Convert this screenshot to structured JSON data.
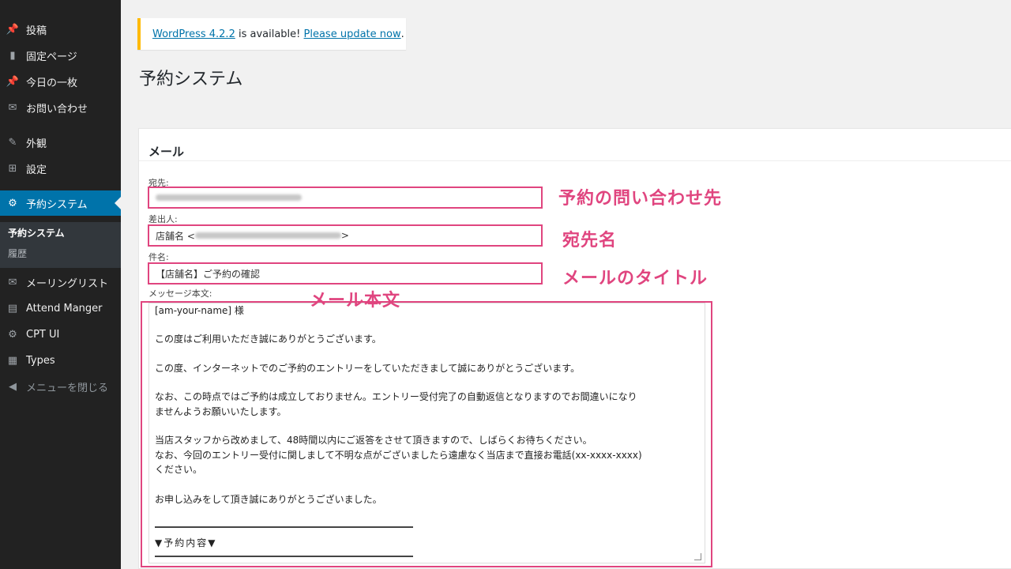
{
  "sidebar": {
    "items": [
      {
        "label": "投稿",
        "icon": "pin-icon"
      },
      {
        "label": "固定ページ",
        "icon": "page-icon"
      },
      {
        "label": "今日の一枚",
        "icon": "pin-icon"
      },
      {
        "label": "お問い合わせ",
        "icon": "mail-icon"
      },
      {
        "label": "外観",
        "icon": "brush-icon"
      },
      {
        "label": "設定",
        "icon": "settings-icon"
      },
      {
        "label": "予約システム",
        "icon": "gear-icon"
      },
      {
        "label": "メーリングリスト",
        "icon": "mail-icon"
      },
      {
        "label": "Attend Manger",
        "icon": "list-icon"
      },
      {
        "label": "CPT UI",
        "icon": "gear-icon"
      },
      {
        "label": "Types",
        "icon": "calendar-icon"
      },
      {
        "label": "メニューを閉じる",
        "icon": "collapse-icon"
      }
    ],
    "submenu": [
      "予約システム",
      "履歴"
    ]
  },
  "notice": {
    "version_link": "WordPress 4.2.2",
    "middle_text": " is available! ",
    "update_link": "Please update now",
    "end_text": "."
  },
  "page_title": "予約システム",
  "panel": {
    "title": "メール",
    "to_label": "宛先:",
    "from_label": "差出人:",
    "from_prefix": "店舗名 <",
    "from_suffix": ">",
    "subject_label": "件名:",
    "subject_value": "【店舗名】ご予約の確認",
    "body_label": "メッセージ本文:",
    "body_lines": [
      "[am-your-name] 様",
      "この度はご利用いただき誠にありがとうございます。",
      "この度、インターネットでのご予約のエントリーをしていただきまして誠にありがとうございます。",
      "なお、この時点ではご予約は成立しておりません。エントリー受付完了の自動返信となりますのでお間違いになり",
      "ませんようお願いいたします。",
      "当店スタッフから改めまして、48時間以内にご返答をさせて頂きますので、しばらくお待ちください。",
      "なお、今回のエントリー受付に関しまして不明な点がございましたら遠慮なく当店まで直接お電話(xx-xxxx-xxxx)",
      "ください。",
      "お申し込みをして頂き誠にありがとうございました。",
      "▼予約内容▼"
    ]
  },
  "annotations": {
    "to": "予約の問い合わせ先",
    "from": "宛先名",
    "subject": "メールのタイトル",
    "body": "メール本文"
  },
  "colors": {
    "accent": "#0073aa",
    "annotation": "#e0457f",
    "notice_border": "#ffba00",
    "sidebar_bg": "#222222"
  }
}
